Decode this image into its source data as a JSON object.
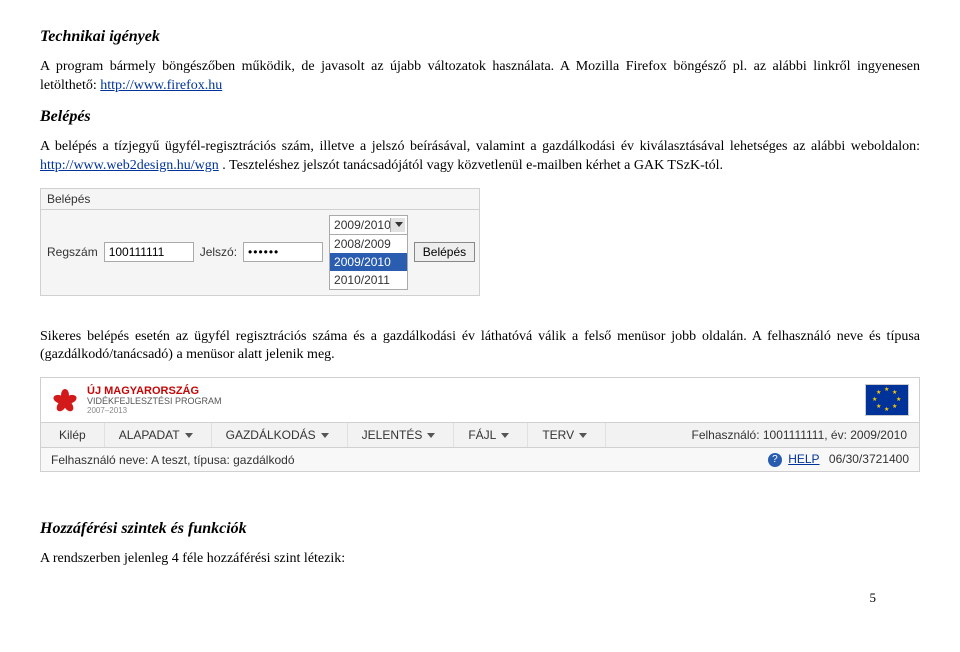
{
  "headings": {
    "tech": "Technikai igények",
    "belepes": "Belépés",
    "hozza": "Hozzáférési szintek és funkciók"
  },
  "paragraphs": {
    "p1a": "A program bármely böngészőben működik, de javasolt az újabb változatok használata. A Mozilla Firefox böngésző pl. az alábbi linkről ingyenesen letölthető: ",
    "p1link": "http://www.firefox.hu",
    "p2a": "A belépés a tízjegyű ügyfél-regisztrációs szám, illetve a jelszó beírásával, valamint a gazdálkodási év kiválasztásával lehetséges az alábbi weboldalon: ",
    "p2link": "http://www.web2design.hu/wgn",
    "p2b": " . Teszteléshez jelszót tanácsadójától vagy közvetlenül e-mailben kérhet a GAK TSzK-tól.",
    "p3": "Sikeres belépés esetén az ügyfél regisztrációs száma és a gazdálkodási év láthatóvá válik a felső menüsor jobb oldalán. A felhasználó neve és típusa (gazdálkodó/tanácsadó) a menüsor alatt jelenik meg.",
    "p4": "A rendszerben jelenleg 4 féle hozzáférési szint létezik:"
  },
  "login": {
    "title": "Belépés",
    "reg_label": "Regszám",
    "reg_value": "100111111",
    "pw_label": "Jelszó:",
    "pw_value": "••••••",
    "year_selected": "2009/2010",
    "options": [
      "2008/2009",
      "2009/2010",
      "2010/2011"
    ],
    "btn": "Belépés"
  },
  "banner": {
    "line1": "ÚJ MAGYARORSZÁG",
    "line2": "VIDÉKFEJLESZTÉSI PROGRAM",
    "line3": "2007–2013"
  },
  "menu": {
    "kilep": "Kilép",
    "items": [
      "ALAPADAT",
      "GAZDÁLKODÁS",
      "JELENTÉS",
      "FÁJL",
      "TERV"
    ],
    "right": "Felhasználó: 1001111111, év: 2009/2010"
  },
  "subbar": {
    "left": "Felhasználó neve: A teszt, típusa: gazdálkodó",
    "help": "HELP",
    "date": "06/30/3721400"
  },
  "pagenum": "5"
}
